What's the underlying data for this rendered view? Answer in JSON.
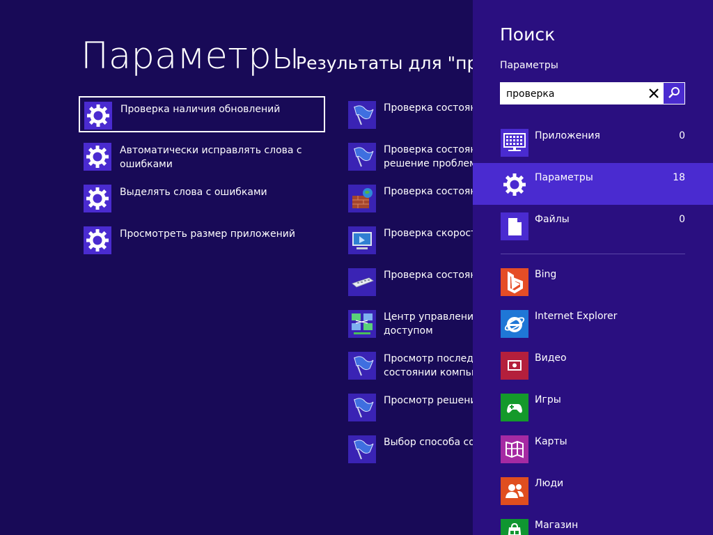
{
  "page": {
    "title": "Параметры",
    "results_header": "Результаты для \"прове"
  },
  "results_left": [
    {
      "label": "Проверка наличия обновлений",
      "icon": "gear-icon"
    },
    {
      "label": "Автоматически исправлять слова с\nошибками",
      "icon": "gear-icon"
    },
    {
      "label": "Выделять слова с ошибками",
      "icon": "gear-icon"
    },
    {
      "label": "Просмотреть размер приложений",
      "icon": "gear-icon"
    }
  ],
  "results_right": [
    {
      "label": "Проверка состояни",
      "icon": "flag-icon"
    },
    {
      "label": "Проверка состояни\nрешение проблем",
      "icon": "flag-icon"
    },
    {
      "label": "Проверка состояни",
      "icon": "firewall-icon"
    },
    {
      "label": "Проверка скорости",
      "icon": "computer-icon"
    },
    {
      "label": "Проверка состояни",
      "icon": "keyboard-icon"
    },
    {
      "label": "Центр управления\nдоступом",
      "icon": "network-icon"
    },
    {
      "label": "Просмотр последн\nсостоянии компью",
      "icon": "flag-icon"
    },
    {
      "label": "Просмотр решения",
      "icon": "flag-icon"
    },
    {
      "label": "Выбор способа сос",
      "icon": "flag-icon"
    }
  ],
  "charm": {
    "title": "Поиск",
    "scope": "Параметры",
    "search_value": "проверка",
    "categories": [
      {
        "label": "Приложения",
        "count": "0",
        "icon": "apps-icon"
      },
      {
        "label": "Параметры",
        "count": "18",
        "icon": "gear-icon"
      },
      {
        "label": "Файлы",
        "count": "0",
        "icon": "file-icon"
      }
    ],
    "apps": [
      {
        "label": "Bing",
        "icon": "bing-icon",
        "color": "#e54d26"
      },
      {
        "label": "Internet Explorer",
        "icon": "ie-icon",
        "color": "#1f77d6"
      },
      {
        "label": "Видео",
        "icon": "video-icon",
        "color": "#b41f3c"
      },
      {
        "label": "Игры",
        "icon": "games-icon",
        "color": "#14992b"
      },
      {
        "label": "Карты",
        "icon": "maps-icon",
        "color": "#a52aa3"
      },
      {
        "label": "Люди",
        "icon": "people-icon",
        "color": "#e04e1f"
      },
      {
        "label": "Магазин",
        "icon": "store-icon",
        "color": "#0f9630"
      }
    ]
  },
  "colors": {
    "background": "#180a57",
    "charm_background": "#2a0f80",
    "accent": "#4a2bd0"
  }
}
